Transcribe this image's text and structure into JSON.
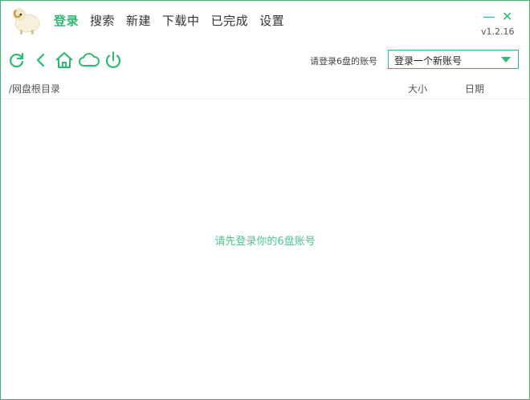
{
  "tabs": [
    {
      "label": "登录",
      "active": true
    },
    {
      "label": "搜索",
      "active": false
    },
    {
      "label": "新建",
      "active": false
    },
    {
      "label": "下载中",
      "active": false
    },
    {
      "label": "已完成",
      "active": false
    },
    {
      "label": "设置",
      "active": false
    }
  ],
  "window": {
    "minimize_label": "—",
    "close_label": "✕",
    "version": "v1.2.16"
  },
  "toolbar": {
    "icons": [
      "refresh-icon",
      "back-icon",
      "home-icon",
      "cloud-icon",
      "power-icon"
    ],
    "account_label": "请登录6盘的账号",
    "account_select_value": "登录一个新账号"
  },
  "list": {
    "path": "/网盘根目录",
    "col_size": "大小",
    "col_date": "日期",
    "empty_message": "请先登录你的6盘账号"
  },
  "colors": {
    "accent": "#2eb872",
    "border": "#3cb371",
    "empty_text": "#4cc58a"
  }
}
